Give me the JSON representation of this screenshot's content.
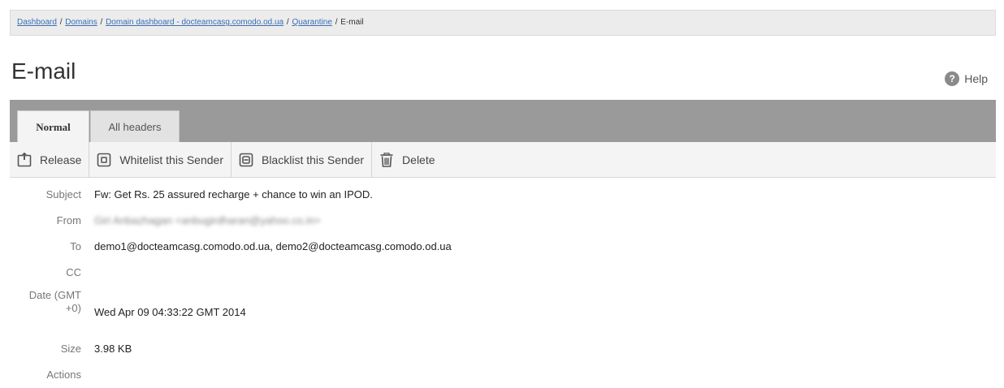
{
  "breadcrumb": {
    "items": [
      "Dashboard",
      "Domains",
      "Domain dashboard - docteamcasg.comodo.od.ua",
      "Quarantine"
    ],
    "current": "E-mail",
    "separator": "/"
  },
  "page": {
    "title": "E-mail",
    "help_label": "Help",
    "help_icon": "question-icon"
  },
  "tabs": [
    {
      "label": "Normal",
      "active": true
    },
    {
      "label": "All headers",
      "active": false
    }
  ],
  "toolbar": {
    "release_label": "Release",
    "whitelist_label": "Whitelist this Sender",
    "blacklist_label": "Blacklist this Sender",
    "delete_label": "Delete"
  },
  "email": {
    "subject_label": "Subject",
    "subject": "Fw: Get Rs. 25 assured recharge + chance to win an IPOD.",
    "from_label": "From",
    "from": "Giri Anbazhagan <anbugirdharan@yahoo.co.in>",
    "to_label": "To",
    "to": "demo1@docteamcasg.comodo.od.ua, demo2@docteamcasg.comodo.od.ua",
    "cc_label": "CC",
    "cc": "",
    "date_label_1": "Date (GMT",
    "date_label_2": "+0)",
    "date": "Wed Apr 09 04:33:22 GMT 2014",
    "size_label": "Size",
    "size": "3.98 KB",
    "actions_label": "Actions"
  },
  "colors": {
    "tab_strip": "#9a9a9a",
    "link": "#3a6fb5",
    "toolbar_bg": "#f4f4f4"
  }
}
